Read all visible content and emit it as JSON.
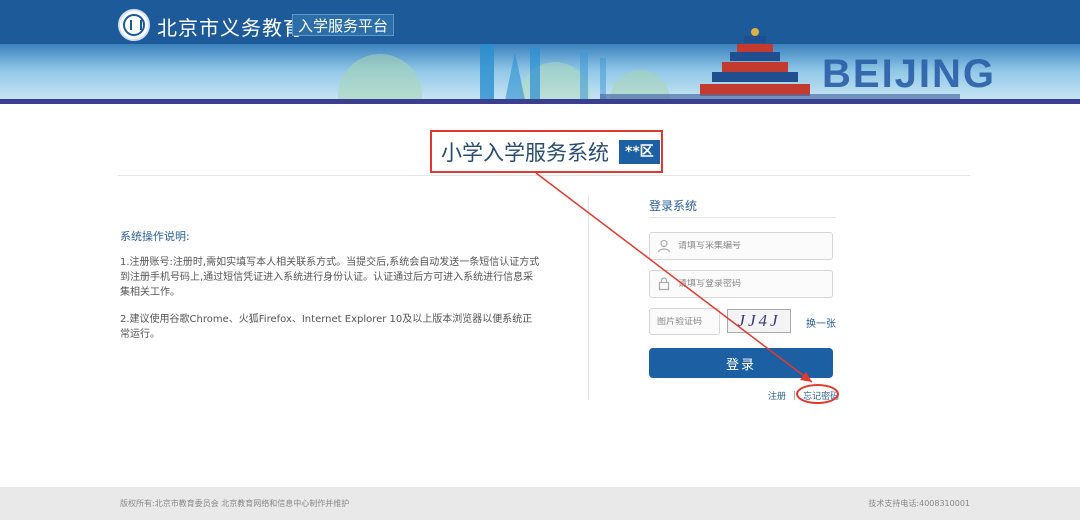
{
  "header": {
    "brand_title": "北京市义务教育",
    "brand_tag": "入学服务平台",
    "city_text": "BEIJING"
  },
  "main": {
    "system_title": "小学入学服务系统",
    "district_badge": "**区"
  },
  "instructions": {
    "heading": "系统操作说明:",
    "p1": "1.注册账号:注册时,需如实填写本人相关联系方式。当提交后,系统会自动发送一条短信认证方式到注册手机号码上,通过短信凭证进入系统进行身份认证。认证通过后方可进入系统进行信息采集相关工作。",
    "p2": "2.建议使用谷歌Chrome、火狐Firefox、Internet Explorer 10及以上版本浏览器以便系统正常运行。"
  },
  "login": {
    "title": "登录系统",
    "username_placeholder": "请填写采集编号",
    "password_placeholder": "请填写登录密码",
    "captcha_placeholder": "图片验证码",
    "captcha_text": "JJ4J",
    "refresh_label": "换一张",
    "login_button": "登录",
    "register_link": "注册",
    "separator": "|",
    "forgot_link": "忘记密码"
  },
  "footer": {
    "copyright": "版权所有:北京市教育委员会 北京教育网络和信息中心制作并维护",
    "support": "技术支持电话:4008310001"
  },
  "colors": {
    "primary": "#1d5fa3",
    "highlight": "#e03a2f",
    "link": "#2a5f96"
  }
}
